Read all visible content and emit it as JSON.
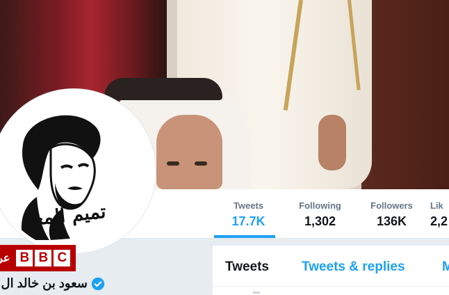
{
  "profile": {
    "display_name": "سعود بن خالد ال ثا",
    "avatar_caption": "تميم المجد"
  },
  "stats": [
    {
      "label": "Tweets",
      "value": "17.7K"
    },
    {
      "label": "Following",
      "value": "1,302"
    },
    {
      "label": "Followers",
      "value": "136K"
    },
    {
      "label": "Lik",
      "value": "2,2"
    }
  ],
  "tabs": {
    "tweets": "Tweets",
    "replies": "Tweets & replies",
    "media": "M"
  },
  "watermark": {
    "letters": [
      "B",
      "B",
      "C"
    ],
    "arabic": "عر"
  },
  "colors": {
    "accent": "#1da1f2",
    "watermark_red": "#b80000"
  },
  "icons": {
    "verified": "verified-badge-icon"
  }
}
